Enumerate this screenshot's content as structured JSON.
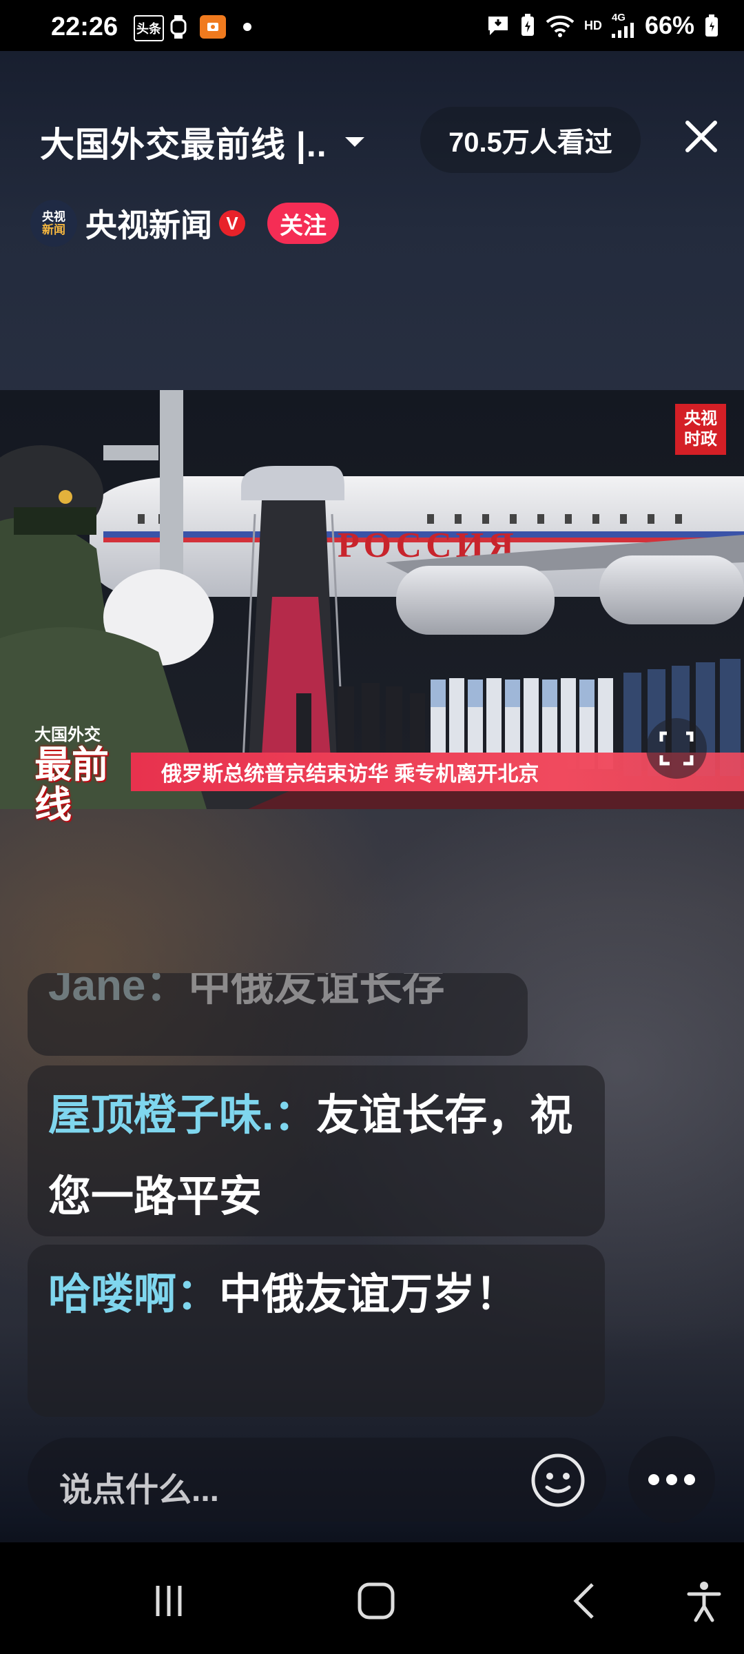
{
  "status_bar": {
    "time": "22:26",
    "app_badge": "头条",
    "network_hd": "HD",
    "network_4g": "4G",
    "battery": "66%"
  },
  "header": {
    "title": "大国外交最前线 |..",
    "viewers": "70.5万人看过",
    "channel": {
      "avatar_line1": "央视",
      "avatar_line2": "新闻",
      "name": "央视新闻",
      "verified_badge": "V",
      "follow_label": "关注"
    }
  },
  "video": {
    "cctv_logo_line1": "央视",
    "cctv_logo_line2": "时政",
    "plane_text": "РОССИЯ",
    "brand_top": "大国外交",
    "brand_main": "最前线",
    "caption": "俄罗斯总统普京结束访华 乘专机离开北京"
  },
  "comments": [
    {
      "user": "Jane：",
      "message": "中俄友谊长存"
    },
    {
      "user": "屋顶橙子味.：",
      "message": "友谊长存，祝您一路平安"
    },
    {
      "user": "哈喽啊：",
      "message": "中俄友谊万岁！"
    }
  ],
  "input": {
    "placeholder": "说点什么..."
  },
  "icons": {
    "close": "close-icon",
    "dropdown": "chevron-down-icon",
    "fullscreen": "fullscreen-icon",
    "emoji": "emoji-icon",
    "more": "more-icon"
  },
  "colors": {
    "follow": "#f52d55",
    "username": "#7fd6ee",
    "caption_bar": "#e8324e",
    "cctv_red": "#d41f26"
  }
}
